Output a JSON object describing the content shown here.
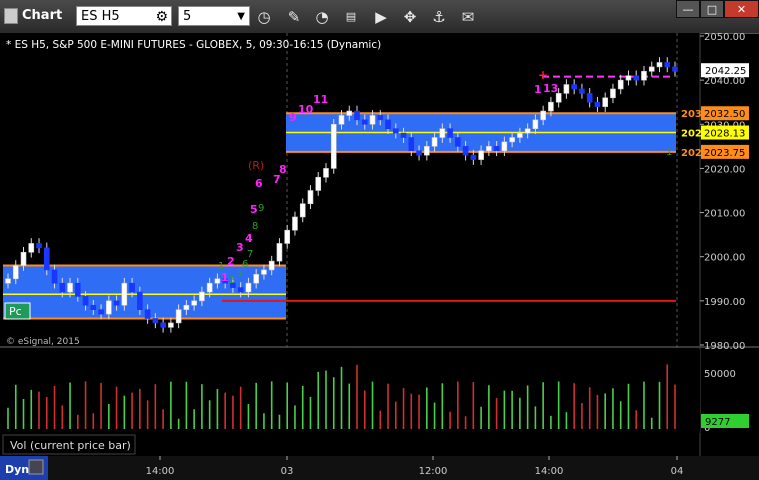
{
  "window": {
    "title": "Chart",
    "minimize": "—",
    "maximize": "□",
    "close": "✕"
  },
  "toolbar": {
    "symbol": "ES H5",
    "interval": "5",
    "icons": [
      "gear-icon",
      "clock-icon",
      "pencil-icon",
      "curve-tool-icon",
      "news-icon",
      "play-icon",
      "cross-arrows-icon",
      "comment-icon"
    ]
  },
  "chart_data": {
    "type": "candlestick",
    "title": "* ES H5, S&P 500 E-MINI FUTURES - GLOBEX, 5, 09:30-16:15 (Dynamic)",
    "copyright": "© eSignal, 2015",
    "price_axis": {
      "ticks": [
        "2050.00",
        "2040.00",
        "2030.00",
        "2020.00",
        "2010.00",
        "2000.00",
        "1990.00",
        "1980.00"
      ],
      "range": [
        1980,
        2051
      ]
    },
    "time_axis": {
      "ticks": [
        "14:00",
        "03",
        "12:00",
        "14:00",
        "04"
      ]
    },
    "last_price": "2042.25",
    "levels": [
      {
        "label": "2032.50",
        "short": "203",
        "color": "#ff8c1a"
      },
      {
        "label": "2028.13",
        "short": "202",
        "color": "#ffff00"
      },
      {
        "label": "2023.75",
        "short": "202",
        "color": "#ff8c1a"
      }
    ],
    "pc_label": "Pc",
    "range_marker": "(R)",
    "sequence_counts": [
      "1",
      "2",
      "3",
      "4",
      "5",
      "6",
      "7",
      "8",
      "9",
      "10",
      "11",
      "13"
    ],
    "setup_digits": [
      "1",
      "3",
      "5",
      "6",
      "7",
      "8",
      "9"
    ],
    "star": "+",
    "tail_count": "1",
    "prior_day_box": {
      "high": 1998,
      "low": 1986,
      "mid": 1991.5
    },
    "day_box": {
      "high": 2032.5,
      "low": 2023.75,
      "mid": 2028.13
    },
    "prior_close_line": 1990,
    "dashed_level": 2040.8,
    "closes": [
      1995,
      1998,
      2001,
      2003,
      2002,
      1997,
      1994,
      1992,
      1994,
      1991,
      1989,
      1988,
      1987,
      1990,
      1989,
      1994,
      1992,
      1988,
      1986,
      1985,
      1984,
      1985,
      1988,
      1989,
      1990,
      1992,
      1994,
      1995,
      1994,
      1993,
      1992,
      1994,
      1996,
      1997,
      1999,
      2003,
      2006,
      2009,
      2012,
      2015,
      2018,
      2020,
      2030,
      2032,
      2033,
      2031,
      2030,
      2032,
      2031,
      2029,
      2028,
      2027,
      2024,
      2023,
      2025,
      2027,
      2029,
      2027,
      2025,
      2023,
      2022,
      2024,
      2025,
      2024,
      2026,
      2027,
      2028,
      2029,
      2031,
      2033,
      2035,
      2037,
      2039,
      2038,
      2037,
      2035,
      2034,
      2036,
      2038,
      2040,
      2041,
      2040,
      2042,
      2043,
      2044,
      2043,
      2042
    ],
    "volume": {
      "ticks": [
        "50000",
        "0"
      ],
      "current": "9277",
      "label": "Vol (current price bar)"
    }
  },
  "bottom": {
    "dyn": "Dyn"
  }
}
